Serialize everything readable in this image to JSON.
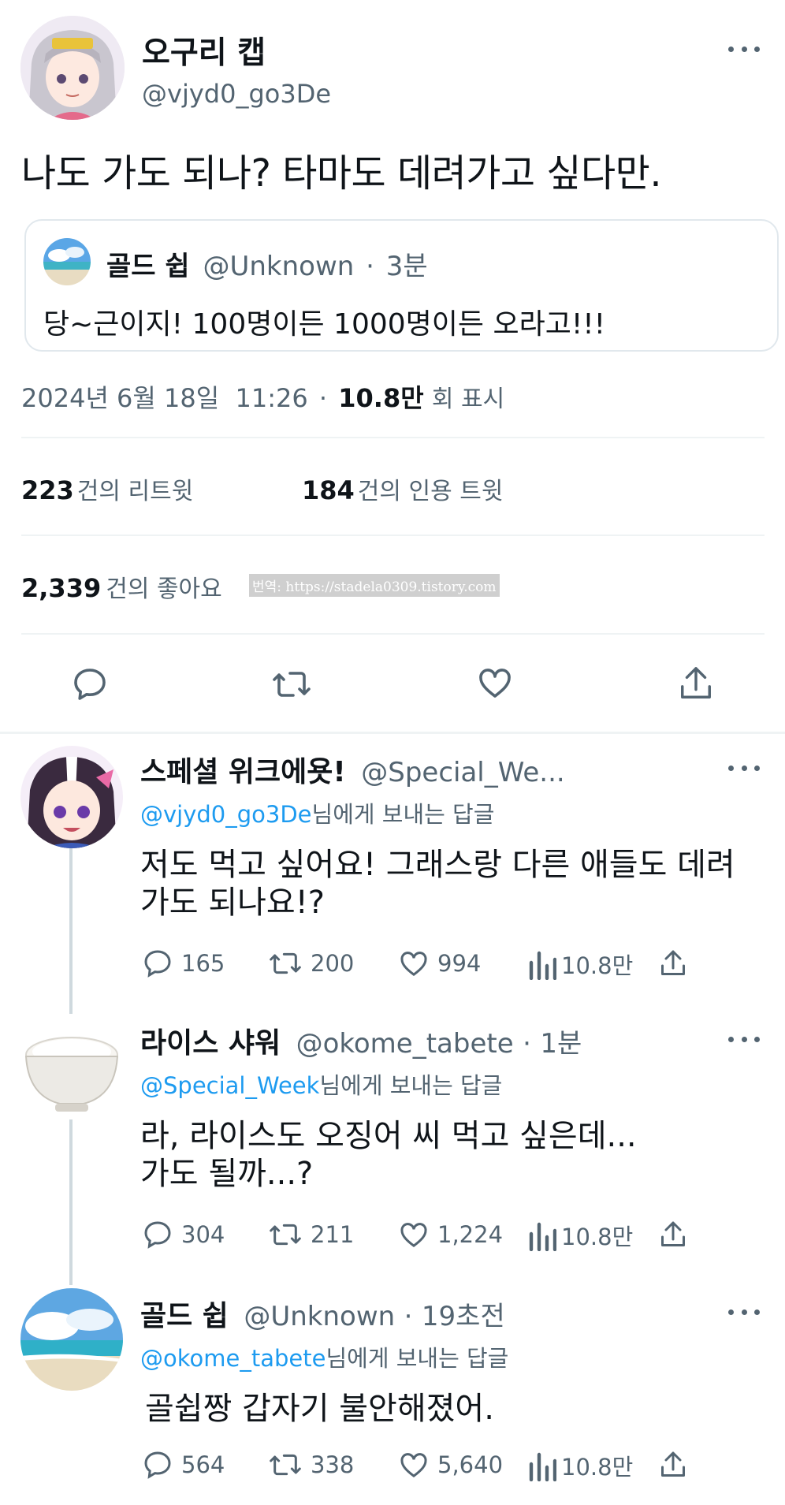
{
  "main_tweet": {
    "display_name": "오구리 캡",
    "handle": "@vjyd0_go3De",
    "text": "나도 가도 되나? 타마도 데려가고 싶다만.",
    "quote": {
      "display_name": "골드 쉽",
      "handle": "@Unknown",
      "dot": "·",
      "time": "3분",
      "text": "당~근이지! 100명이든 1000명이든 오라고!!!"
    },
    "meta": {
      "datetime": "2024년 6월 18일  11:26",
      "dot": "·",
      "views": "10.8만",
      "views_label": "회 표시"
    },
    "stats": {
      "retweets": "223",
      "retweets_label": "건의 리트윗",
      "quotes": "184",
      "quotes_label": "건의 인용 트윗",
      "likes": "2,339",
      "likes_label": "건의 좋아요"
    },
    "watermark": "번역: https://stadela0309.tistory.com"
  },
  "replies": [
    {
      "display_name": "스페셜 위크에욧!",
      "handle": "@Special_We...",
      "reply_to": "@vjyd0_go3De",
      "reply_suffix": "님에게 보내는 답글",
      "text_line1": "저도 먹고 싶어요! 그래스랑 다른 애들도 데려",
      "text_line2": "가도 되나요!?",
      "comments": "165",
      "retweets": "200",
      "likes": "994",
      "views": "10.8만"
    },
    {
      "display_name": "라이스 샤워",
      "handle": "@okome_tabete",
      "dot": "·",
      "time": "1분",
      "reply_to": "@Special_Week",
      "reply_suffix": "님에게 보내는 답글",
      "text_line1": "라, 라이스도 오징어 씨 먹고 싶은데...",
      "text_line2": "가도 될까...?",
      "comments": "304",
      "retweets": "211",
      "likes": "1,224",
      "views": "10.8만"
    },
    {
      "display_name": "골드 쉽",
      "handle": "@Unknown",
      "dot": "·",
      "time": "19초전",
      "reply_to": "@okome_tabete",
      "reply_suffix": "님에게 보내는 답글",
      "text_line1": "골쉽짱 갑자기 불안해졌어.",
      "comments": "564",
      "retweets": "338",
      "likes": "5,640",
      "views": "10.8만"
    }
  ],
  "colors": {
    "link": "#1d9bf0",
    "secondary": "#536471",
    "divider": "#eff3f4"
  }
}
